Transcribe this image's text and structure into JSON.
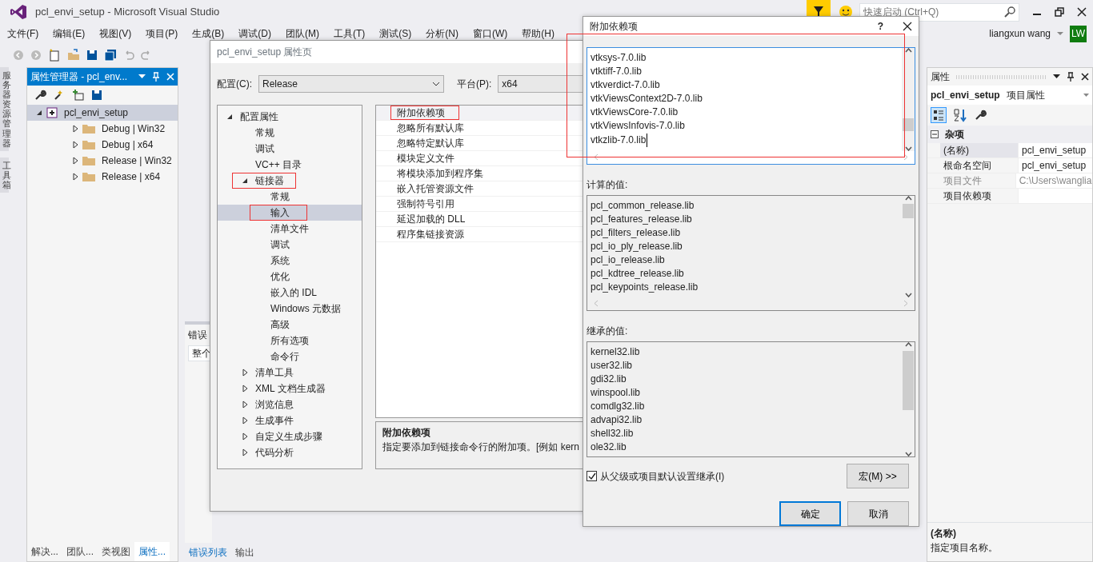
{
  "window": {
    "title": "pcl_envi_setup - Microsoft Visual Studio"
  },
  "title_bar": {
    "quick_launch": {
      "placeholder": "快速启动 (Ctrl+Q)"
    },
    "user": "liangxun wang",
    "avatar": "LW"
  },
  "menu": [
    "文件(F)",
    "编辑(E)",
    "视图(V)",
    "项目(P)",
    "生成(B)",
    "调试(D)",
    "团队(M)",
    "工具(T)",
    "测试(S)",
    "分析(N)",
    "窗口(W)",
    "帮助(H)"
  ],
  "side_tabs": [
    "服务器资源管理器",
    "工具箱"
  ],
  "property_manager": {
    "title": "属性管理器 - pcl_env...",
    "tree": [
      {
        "label": "pcl_envi_setup",
        "expanded": true,
        "selected": true,
        "children": [
          {
            "label": "Debug | Win32",
            "expanded": false,
            "selected": false
          },
          {
            "label": "Debug | x64",
            "expanded": false,
            "selected": false
          },
          {
            "label": "Release | Win32",
            "expanded": false,
            "selected": false
          },
          {
            "label": "Release | x64",
            "expanded": false,
            "selected": false
          }
        ]
      }
    ],
    "tabs": [
      {
        "label": "解决...",
        "selected": false
      },
      {
        "label": "团队...",
        "selected": false
      },
      {
        "label": "类视图",
        "selected": false
      },
      {
        "label": "属性...",
        "selected": true
      }
    ]
  },
  "error_list": {
    "title": "错误",
    "scope": "整个",
    "tabs": [
      {
        "label": "错误列表",
        "selected": true
      },
      {
        "label": "输出",
        "selected": false
      }
    ]
  },
  "property_pages": {
    "title": "pcl_envi_setup 属性页",
    "config_label": "配置(C):",
    "config": "Release",
    "platform_label": "平台(P):",
    "platform": "x64",
    "tree": [
      {
        "label": "配置属性",
        "expanded": true,
        "selected": false,
        "highlighted": false,
        "children": [
          {
            "label": "常规",
            "selected": false,
            "highlighted": false
          },
          {
            "label": "调试",
            "selected": false,
            "highlighted": false
          },
          {
            "label": "VC++ 目录",
            "selected": false,
            "highlighted": false
          },
          {
            "label": "链接器",
            "expanded": true,
            "selected": false,
            "highlighted": true,
            "children": [
              {
                "label": "常规",
                "selected": false,
                "highlighted": false
              },
              {
                "label": "输入",
                "selected": true,
                "highlighted": true
              },
              {
                "label": "清单文件",
                "selected": false,
                "highlighted": false
              },
              {
                "label": "调试",
                "selected": false,
                "highlighted": false
              },
              {
                "label": "系统",
                "selected": false,
                "highlighted": false
              },
              {
                "label": "优化",
                "selected": false,
                "highlighted": false
              },
              {
                "label": "嵌入的 IDL",
                "selected": false,
                "highlighted": false
              },
              {
                "label": "Windows 元数据",
                "selected": false,
                "highlighted": false
              },
              {
                "label": "高级",
                "selected": false,
                "highlighted": false
              },
              {
                "label": "所有选项",
                "selected": false,
                "highlighted": false
              },
              {
                "label": "命令行",
                "selected": false,
                "highlighted": false
              }
            ]
          },
          {
            "label": "清单工具",
            "expanded": false,
            "selected": false,
            "highlighted": false
          },
          {
            "label": "XML 文档生成器",
            "expanded": false,
            "selected": false,
            "highlighted": false
          },
          {
            "label": "浏览信息",
            "expanded": false,
            "selected": false,
            "highlighted": false
          },
          {
            "label": "生成事件",
            "expanded": false,
            "selected": false,
            "highlighted": false
          },
          {
            "label": "自定义生成步骤",
            "expanded": false,
            "selected": false,
            "highlighted": false
          },
          {
            "label": "代码分析",
            "expanded": false,
            "selected": false,
            "highlighted": false
          }
        ]
      }
    ],
    "properties": [
      {
        "label": "附加依赖项",
        "selected": true,
        "highlighted": true
      },
      {
        "label": "忽略所有默认库",
        "selected": false,
        "highlighted": false
      },
      {
        "label": "忽略特定默认库",
        "selected": false,
        "highlighted": false
      },
      {
        "label": "模块定义文件",
        "selected": false,
        "highlighted": false
      },
      {
        "label": "将模块添加到程序集",
        "selected": false,
        "highlighted": false
      },
      {
        "label": "嵌入托管资源文件",
        "selected": false,
        "highlighted": false
      },
      {
        "label": "强制符号引用",
        "selected": false,
        "highlighted": false
      },
      {
        "label": "延迟加载的 DLL",
        "selected": false,
        "highlighted": false
      },
      {
        "label": "程序集链接资源",
        "selected": false,
        "highlighted": false
      }
    ],
    "description": {
      "title": "附加依赖项",
      "text": "指定要添加到链接命令行的附加项。[例如 kern"
    }
  },
  "dependencies_dialog": {
    "title": "附加依赖项",
    "help": "?",
    "highlighted": true,
    "edit_lines": [
      "vtksys-7.0.lib",
      "vtktiff-7.0.lib",
      "vtkverdict-7.0.lib",
      "vtkViewsContext2D-7.0.lib",
      "vtkViewsCore-7.0.lib",
      "vtkViewsInfovis-7.0.lib",
      "vtkzlib-7.0.lib"
    ],
    "computed_label": "计算的值:",
    "computed": [
      "pcl_common_release.lib",
      "pcl_features_release.lib",
      "pcl_filters_release.lib",
      "pcl_io_ply_release.lib",
      "pcl_io_release.lib",
      "pcl_kdtree_release.lib",
      "pcl_keypoints_release.lib"
    ],
    "inherited_label": "继承的值:",
    "inherited": [
      "kernel32.lib",
      "user32.lib",
      "gdi32.lib",
      "winspool.lib",
      "comdlg32.lib",
      "advapi32.lib",
      "shell32.lib",
      "ole32.lib"
    ],
    "inherit": {
      "label": "从父级或项目默认设置继承(I)",
      "checked": true
    },
    "macros_button": "宏(M) >>",
    "ok_button": "确定",
    "cancel_button": "取消"
  },
  "properties_panel": {
    "title": "属性",
    "object": "pcl_envi_setup",
    "object_type": "项目属性",
    "category": "杂项",
    "category_expanded": true,
    "rows": [
      {
        "name": "(名称)",
        "value": "pcl_envi_setup",
        "disabled": false,
        "selected": true
      },
      {
        "name": "根命名空间",
        "value": "pcl_envi_setup",
        "disabled": false,
        "selected": false
      },
      {
        "name": "项目文件",
        "value": "C:\\Users\\wanglia",
        "disabled": true,
        "selected": false
      },
      {
        "name": "项目依赖项",
        "disabled": false,
        "selected": false
      }
    ],
    "description": {
      "title": "(名称)",
      "text": "指定项目名称。"
    }
  }
}
